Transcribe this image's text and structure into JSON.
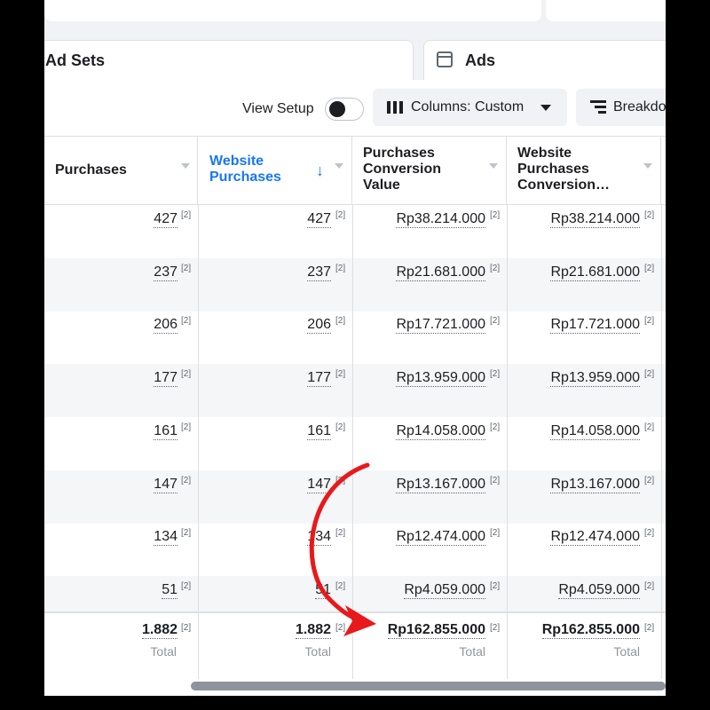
{
  "tabs": {
    "adsets_label": "Ad Sets",
    "ads_label": "Ads"
  },
  "toolbar": {
    "view_setup_label": "View Setup",
    "view_setup_on": false,
    "columns_label": "Columns: Custom",
    "breakdown_label": "Breakdown"
  },
  "columns": [
    {
      "label": "Purchases",
      "sorted": false
    },
    {
      "label": "Website Purchases",
      "sorted": true,
      "sort_direction": "descending"
    },
    {
      "label": "Purchases Conversion Value",
      "sorted": false
    },
    {
      "label": "Website Purchases Conversion…",
      "sorted": false
    }
  ],
  "footnote_marker": "[2]",
  "rows": [
    {
      "purchases": "427",
      "website_purchases": "427",
      "conversion_value": "Rp38.214.000",
      "website_conversion_value": "Rp38.214.000"
    },
    {
      "purchases": "237",
      "website_purchases": "237",
      "conversion_value": "Rp21.681.000",
      "website_conversion_value": "Rp21.681.000"
    },
    {
      "purchases": "206",
      "website_purchases": "206",
      "conversion_value": "Rp17.721.000",
      "website_conversion_value": "Rp17.721.000"
    },
    {
      "purchases": "177",
      "website_purchases": "177",
      "conversion_value": "Rp13.959.000",
      "website_conversion_value": "Rp13.959.000"
    },
    {
      "purchases": "161",
      "website_purchases": "161",
      "conversion_value": "Rp14.058.000",
      "website_conversion_value": "Rp14.058.000"
    },
    {
      "purchases": "147",
      "website_purchases": "147",
      "conversion_value": "Rp13.167.000",
      "website_conversion_value": "Rp13.167.000"
    },
    {
      "purchases": "134",
      "website_purchases": "134",
      "conversion_value": "Rp12.474.000",
      "website_conversion_value": "Rp12.474.000"
    },
    {
      "purchases": "51",
      "website_purchases": "51",
      "conversion_value": "Rp4.059.000",
      "website_conversion_value": "Rp4.059.000"
    }
  ],
  "totals": {
    "purchases": "1.882",
    "website_purchases": "1.882",
    "conversion_value": "Rp162.855.000",
    "website_conversion_value": "Rp162.855.000",
    "label": "Total"
  },
  "colors": {
    "accent": "#1877f2",
    "annotation_arrow": "#e8191b",
    "frame": "#000000"
  },
  "annotation": {
    "type": "curved-arrow",
    "points_to": "totals.conversion_value"
  }
}
